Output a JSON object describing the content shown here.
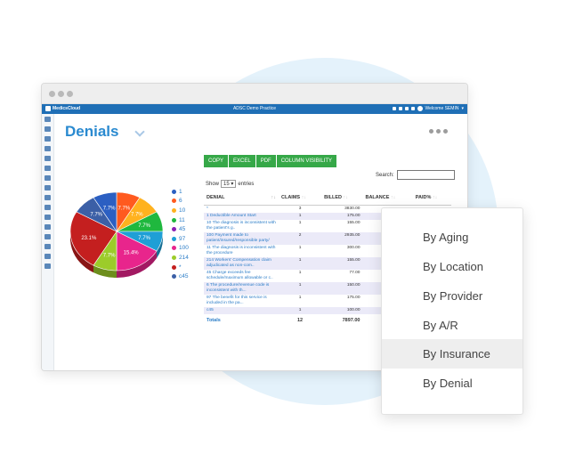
{
  "app": {
    "logo_text": "MedicsCloud",
    "page_title": "ADSC Demo Practice",
    "user_label": "Welcome SEMIN"
  },
  "page": {
    "title": "Denials"
  },
  "toolbar": {
    "buttons": [
      "COPY",
      "EXCEL",
      "PDF",
      "COLUMN VISIBILITY"
    ]
  },
  "table_controls": {
    "show_label": "Show",
    "entries_value": "15",
    "entries_label": "entries",
    "search_label": "Search:"
  },
  "table": {
    "headers": [
      "DENIAL",
      "CLAIMS",
      "BILLED",
      "BALANCE",
      "PAID%"
    ],
    "rows": [
      {
        "denial": "*",
        "claims": "3",
        "billed": "3830.00"
      },
      {
        "denial": "1 Deductible Amount Start",
        "claims": "1",
        "billed": "175.00"
      },
      {
        "denial": "10 The diagnosis is inconsistent with the patient's g..",
        "claims": "1",
        "billed": "155.00"
      },
      {
        "denial": "100 Payment made to patient/insured/responsible party/",
        "claims": "2",
        "billed": "2935.00"
      },
      {
        "denial": "11 The diagnosis is inconsistent with the procedure",
        "claims": "1",
        "billed": "300.00"
      },
      {
        "denial": "214 Workers' Compensation claim adjudicated as non-com..",
        "claims": "1",
        "billed": "155.00"
      },
      {
        "denial": "45 Charge exceeds fee schedule/maximum allowable or c..",
        "claims": "1",
        "billed": "77.00"
      },
      {
        "denial": "6 The procedure/revenue code is inconsistent with th...",
        "claims": "1",
        "billed": "150.00"
      },
      {
        "denial": "97 The benefit for this service is included in the pa...",
        "claims": "1",
        "billed": "175.00"
      },
      {
        "denial": "c45",
        "claims": "1",
        "billed": "100.00"
      }
    ],
    "totals": {
      "label": "Totals",
      "claims": "12",
      "billed": "7897.00"
    }
  },
  "chart_data": {
    "type": "pie",
    "categories": [
      "1",
      "6",
      "10",
      "11",
      "45",
      "97",
      "100",
      "214",
      "*",
      "c45"
    ],
    "values": [
      7.7,
      7.7,
      7.7,
      7.7,
      7.7,
      7.7,
      15.4,
      7.7,
      23.1,
      7.7
    ],
    "slices_in_draw_order": [
      {
        "label": "6",
        "value": 7.7,
        "color": "#ff5a1f"
      },
      {
        "label": "10",
        "value": 7.7,
        "color": "#ffb21f"
      },
      {
        "label": "11",
        "value": 7.7,
        "color": "#1fb83e"
      },
      {
        "label": "97",
        "value": 7.7,
        "color": "#1f9fd6"
      },
      {
        "label": "100",
        "value": 15.4,
        "color": "#e8258c"
      },
      {
        "label": "214",
        "value": 7.7,
        "color": "#9ccc2a"
      },
      {
        "label": "*",
        "value": 23.1,
        "color": "#c41f1f"
      },
      {
        "label": "c45",
        "value": 7.7,
        "color": "#3b5fa6"
      },
      {
        "label": "1",
        "value": 7.7,
        "color": "#2b5fc2"
      }
    ],
    "legend": [
      {
        "label": "1",
        "color": "#2b5fc2"
      },
      {
        "label": "6",
        "color": "#ff5a1f"
      },
      {
        "label": "10",
        "color": "#ffb21f"
      },
      {
        "label": "11",
        "color": "#1fb83e"
      },
      {
        "label": "45",
        "color": "#8b1fb5"
      },
      {
        "label": "97",
        "color": "#1f9fd6"
      },
      {
        "label": "100",
        "color": "#e8258c"
      },
      {
        "label": "214",
        "color": "#9ccc2a"
      },
      {
        "label": "*",
        "color": "#c41f1f"
      },
      {
        "label": "c45",
        "color": "#3b5fa6"
      }
    ],
    "legend_position": "right"
  },
  "report_menu": {
    "items": [
      "By Aging",
      "By Location",
      "By Provider",
      "By A/R",
      "By Insurance",
      "By Denial"
    ],
    "active": "By Insurance"
  }
}
